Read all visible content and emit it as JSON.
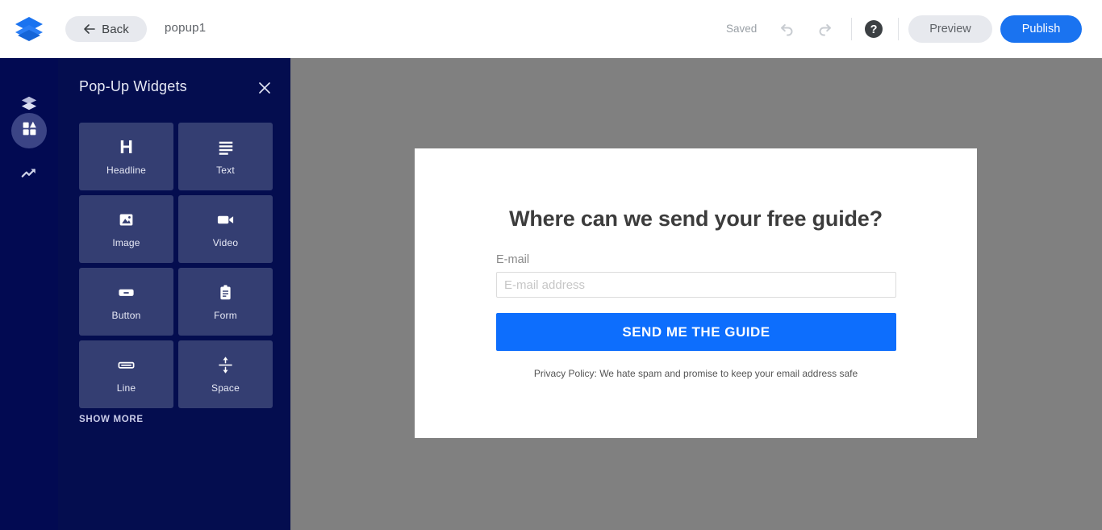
{
  "topbar": {
    "logo_icon": "layers-logo-icon",
    "back_label": "Back",
    "back_icon": "arrow-left-icon",
    "doc_title": "popup1",
    "save_status": "Saved",
    "undo_icon": "undo-icon",
    "redo_icon": "redo-icon",
    "help_icon": "help-circle-icon",
    "preview_label": "Preview",
    "publish_label": "Publish",
    "accent_color": "#1a73f0",
    "pill_bg_color": "#e7e9ee"
  },
  "rail": {
    "items": [
      {
        "name": "layers",
        "icon": "layers-icon",
        "active": false
      },
      {
        "name": "widgets",
        "icon": "widgets-icon",
        "active": true
      },
      {
        "name": "analytics",
        "icon": "trending-up-icon",
        "active": false
      }
    ],
    "bg_color": "#020a52",
    "active_bg_color": "#3b4485"
  },
  "panel": {
    "title": "Pop-Up Widgets",
    "close_icon": "close-icon",
    "show_more_label": "SHOW MORE",
    "bg_color": "#040d4f",
    "tile_color": "#343e72",
    "widgets": [
      {
        "label": "Headline",
        "icon": "heading-h-icon"
      },
      {
        "label": "Text",
        "icon": "text-lines-icon"
      },
      {
        "label": "Image",
        "icon": "image-icon"
      },
      {
        "label": "Video",
        "icon": "video-camera-icon"
      },
      {
        "label": "Button",
        "icon": "button-icon"
      },
      {
        "label": "Form",
        "icon": "form-clipboard-icon"
      },
      {
        "label": "Line",
        "icon": "line-icon"
      },
      {
        "label": "Space",
        "icon": "space-arrows-icon"
      }
    ]
  },
  "canvas": {
    "bg_color": "#808080",
    "popup": {
      "headline": "Where can we send your free guide?",
      "email_label": "E-mail",
      "email_value": "",
      "email_placeholder": "E-mail address",
      "submit_label": "SEND ME THE GUIDE",
      "submit_color": "#0d6efd",
      "privacy_text": "Privacy Policy: We hate spam and promise to keep your email address safe"
    }
  }
}
